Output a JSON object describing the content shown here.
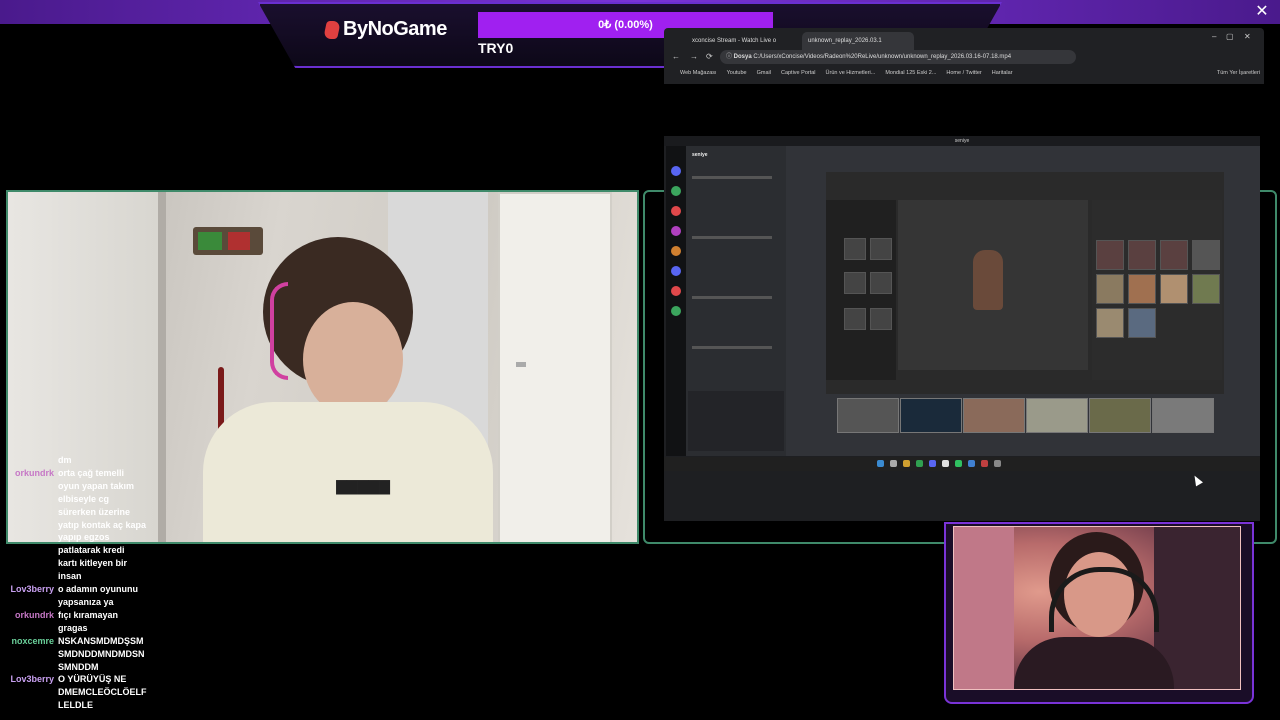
{
  "overlay": {
    "logo_text": "ByNoGame",
    "progress_text": "0₺ (0.00%)",
    "progress_fraction": 0.0,
    "goal_label": "TRY0",
    "accent_color": "#a020f0",
    "frame_color": "#3f8a6a"
  },
  "browser": {
    "tabs": [
      {
        "label": "xconcise Stream - Watch Live o",
        "active": false
      },
      {
        "label": "unknown_replay_2026.03.1",
        "active": true
      }
    ],
    "url_prefix": "Dosya",
    "url": "C:/Users/xConcise/Videos/Radeon%20ReLive/unknown/unknown_replay_2026.03.16-07.18.mp4",
    "bookmarks": [
      "Web Mağazası",
      "Youtube",
      "Gmail",
      "Captive Portal",
      "Ürün ve Hizmetleri...",
      "Mondial 125 Eski 2...",
      "Home / Twitter",
      "Haritalar",
      "Tüm Yer İşaretleri"
    ]
  },
  "screen_share": {
    "window_title": "seniye",
    "discord_server": "seniye"
  },
  "chat": {
    "messages": [
      {
        "user": "",
        "user_color": "#ffffff",
        "text": "dm"
      },
      {
        "user": "orkundrk",
        "user_color": "#c678c6",
        "text": "orta çağ temelli"
      },
      {
        "user": "",
        "user_color": "#ffffff",
        "text": "oyun yapan takım"
      },
      {
        "user": "",
        "user_color": "#ffffff",
        "text": "elbiseyle cg"
      },
      {
        "user": "",
        "user_color": "#ffffff",
        "text": "sürerken üzerine"
      },
      {
        "user": "",
        "user_color": "#ffffff",
        "text": "yatıp kontak aç kapa"
      },
      {
        "user": "",
        "user_color": "#ffffff",
        "text": "yapıp egzos"
      },
      {
        "user": "",
        "user_color": "#ffffff",
        "text": "patlatarak kredi"
      },
      {
        "user": "",
        "user_color": "#ffffff",
        "text": "kartı kitleyen bir"
      },
      {
        "user": "",
        "user_color": "#ffffff",
        "text": "insan"
      },
      {
        "user": "Lov3berry",
        "user_color": "#c8a0f0",
        "text": "o adamın oyununu"
      },
      {
        "user": "",
        "user_color": "#ffffff",
        "text": "yapsanıza ya"
      },
      {
        "user": "orkundrk",
        "user_color": "#c678c6",
        "text": "fıçı kıramayan"
      },
      {
        "user": "",
        "user_color": "#ffffff",
        "text": "gragas"
      },
      {
        "user": "noxcemre",
        "user_color": "#6ad09a",
        "text": "NSKANSMDMDŞSM"
      },
      {
        "user": "",
        "user_color": "#ffffff",
        "text": "SMDNDDMNDMDSN"
      },
      {
        "user": "",
        "user_color": "#ffffff",
        "text": "SMNDDM"
      },
      {
        "user": "Lov3berry",
        "user_color": "#c8a0f0",
        "text": "O YÜRÜYÜŞ NE"
      },
      {
        "user": "",
        "user_color": "#ffffff",
        "text": "DMEMCLEÖCLÖELF"
      },
      {
        "user": "",
        "user_color": "#ffffff",
        "text": "LELDLE"
      }
    ]
  }
}
